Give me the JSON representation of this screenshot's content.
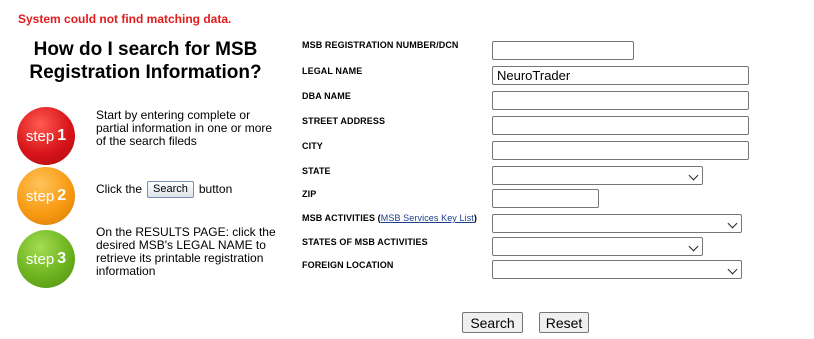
{
  "error_message": "System could not find matching data.",
  "heading": "How do I search for MSB Registration Information?",
  "steps": [
    {
      "word": "step",
      "number": "1",
      "text": "Start by entering complete or partial information in one or more of the search fileds"
    },
    {
      "word": "step",
      "number": "2",
      "text_before": "Click the",
      "button_label": "Search",
      "text_after": "button"
    },
    {
      "word": "step",
      "number": "3",
      "text": "On the RESULTS PAGE: click the desired MSB's LEGAL NAME to retrieve its printable registration information"
    }
  ],
  "form": {
    "msb_registration_number": {
      "label": "MSB REGISTRATION NUMBER/DCN",
      "value": ""
    },
    "legal_name": {
      "label": "LEGAL NAME",
      "value": "NeuroTrader"
    },
    "dba_name": {
      "label": "DBA NAME",
      "value": ""
    },
    "street_address": {
      "label": "STREET ADDRESS",
      "value": ""
    },
    "city": {
      "label": "CITY",
      "value": ""
    },
    "state": {
      "label": "STATE",
      "value": ""
    },
    "zip": {
      "label": "ZIP",
      "value": ""
    },
    "msb_activities": {
      "label": "MSB ACTIVITIES",
      "link_text": "MSB Services Key List",
      "value": ""
    },
    "states_of_msb_activities": {
      "label": "STATES OF MSB ACTIVITIES",
      "value": ""
    },
    "foreign_location": {
      "label": "FOREIGN LOCATION",
      "value": ""
    }
  },
  "buttons": {
    "search": "Search",
    "reset": "Reset"
  }
}
